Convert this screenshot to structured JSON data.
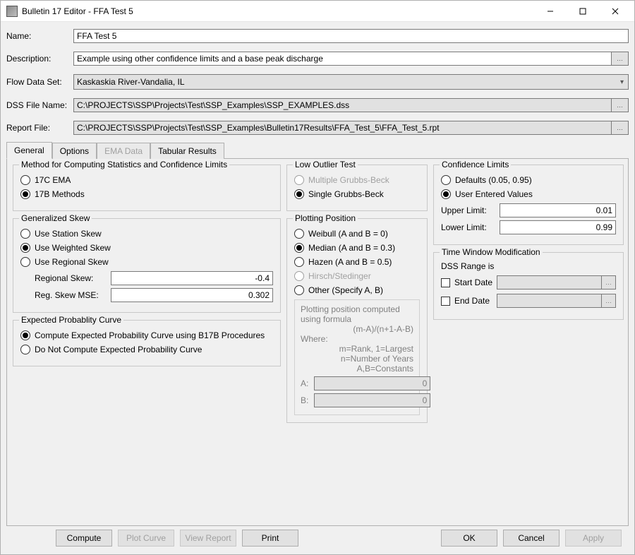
{
  "window": {
    "title": "Bulletin 17 Editor - FFA Test 5"
  },
  "form": {
    "name_label": "Name:",
    "name_value": "FFA Test 5",
    "desc_label": "Description:",
    "desc_value": "Example using other confidence limits and a base peak discharge",
    "flow_label": "Flow Data Set:",
    "flow_value": "Kaskaskia River-Vandalia, IL",
    "dss_label": "DSS File Name:",
    "dss_value": "C:\\PROJECTS\\SSP\\Projects\\Test\\SSP_Examples\\SSP_EXAMPLES.dss",
    "report_label": "Report File:",
    "report_value": "C:\\PROJECTS\\SSP\\Projects\\Test\\SSP_Examples\\Bulletin17Results\\FFA_Test_5\\FFA_Test_5.rpt"
  },
  "tabs": {
    "general": "General",
    "options": "Options",
    "ema": "EMA Data",
    "tabular": "Tabular Results"
  },
  "method": {
    "legend": "Method for Computing Statistics and Confidence Limits",
    "opt1": "17C EMA",
    "opt2": "17B Methods"
  },
  "skew": {
    "legend": "Generalized Skew",
    "opt1": "Use Station Skew",
    "opt2": "Use Weighted Skew",
    "opt3": "Use Regional Skew",
    "reg_label": "Regional Skew:",
    "reg_value": "-0.4",
    "mse_label": "Reg. Skew MSE:",
    "mse_value": "0.302"
  },
  "expected": {
    "legend": "Expected Probablity Curve",
    "opt1": "Compute Expected Probability Curve using B17B Procedures",
    "opt2": "Do Not Compute Expected Probability Curve"
  },
  "outlier": {
    "legend": "Low Outlier Test",
    "opt1": "Multiple Grubbs-Beck",
    "opt2": "Single Grubbs-Beck"
  },
  "plot": {
    "legend": "Plotting Position",
    "opt1": "Weibull (A and B = 0)",
    "opt2": "Median (A and B = 0.3)",
    "opt3": "Hazen (A and B = 0.5)",
    "opt4": "Hirsch/Stedinger",
    "opt5": "Other (Specify A, B)",
    "formula1": "Plotting position computed using formula",
    "formula2": "(m-A)/(n+1-A-B)",
    "where": "Where:",
    "m": "m=Rank, 1=Largest",
    "n": "n=Number of Years",
    "ab": "A,B=Constants",
    "a_label": "A:",
    "a_value": "0",
    "b_label": "B:",
    "b_value": "0"
  },
  "conf": {
    "legend": "Confidence Limits",
    "opt1": "Defaults (0.05, 0.95)",
    "opt2": "User Entered Values",
    "upper_label": "Upper Limit:",
    "upper_value": "0.01",
    "lower_label": "Lower Limit:",
    "lower_value": "0.99"
  },
  "timewin": {
    "legend": "Time Window Modification",
    "range": "DSS Range is",
    "start": "Start Date",
    "end": "End Date"
  },
  "buttons": {
    "compute": "Compute",
    "plot": "Plot Curve",
    "view": "View Report",
    "print": "Print",
    "ok": "OK",
    "cancel": "Cancel",
    "apply": "Apply"
  }
}
